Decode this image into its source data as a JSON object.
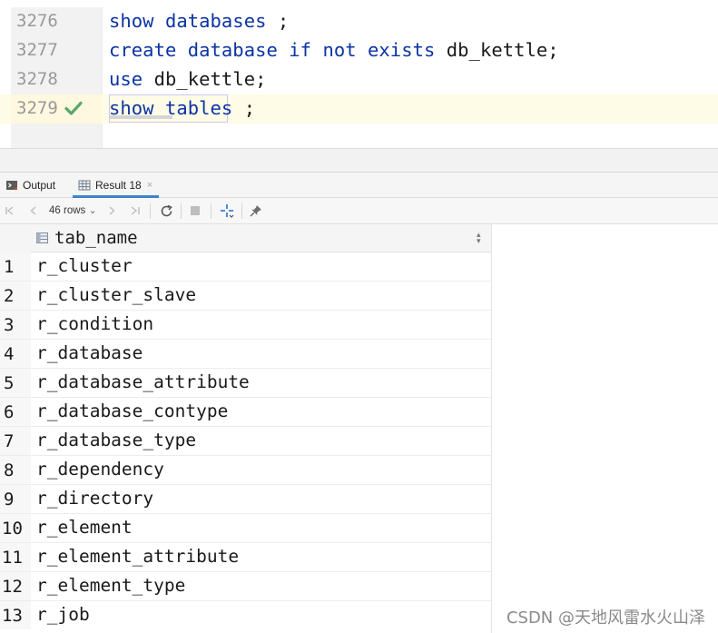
{
  "editor": {
    "lines": [
      {
        "number": "3276",
        "keywords": "show databases",
        "rest": " ;"
      },
      {
        "number": "3277",
        "keywords": "create database if not exists",
        "rest": " db_kettle;"
      },
      {
        "number": "3278",
        "keywords": "use",
        "rest": " db_kettle;"
      },
      {
        "number": "3279",
        "keywords": "show tables",
        "rest": " ;"
      }
    ]
  },
  "tabs": {
    "output_label": "Output",
    "result_label": "Result 18",
    "result_close": "×"
  },
  "toolbar": {
    "rows_label": "46 rows",
    "rows_chevron": "⌄"
  },
  "grid": {
    "column": "tab_name",
    "rows": [
      {
        "n": "1",
        "v": "r_cluster"
      },
      {
        "n": "2",
        "v": "r_cluster_slave"
      },
      {
        "n": "3",
        "v": "r_condition"
      },
      {
        "n": "4",
        "v": "r_database"
      },
      {
        "n": "5",
        "v": "r_database_attribute"
      },
      {
        "n": "6",
        "v": "r_database_contype"
      },
      {
        "n": "7",
        "v": "r_database_type"
      },
      {
        "n": "8",
        "v": "r_dependency"
      },
      {
        "n": "9",
        "v": "r_directory"
      },
      {
        "n": "10",
        "v": "r_element"
      },
      {
        "n": "11",
        "v": "r_element_attribute"
      },
      {
        "n": "12",
        "v": "r_element_type"
      },
      {
        "n": "13",
        "v": "r_job"
      }
    ]
  },
  "watermark": "CSDN @天地风雷水火山泽",
  "colors": {
    "keyword": "#0b33a5",
    "current_line": "#fefbe6",
    "check": "#59a869"
  }
}
